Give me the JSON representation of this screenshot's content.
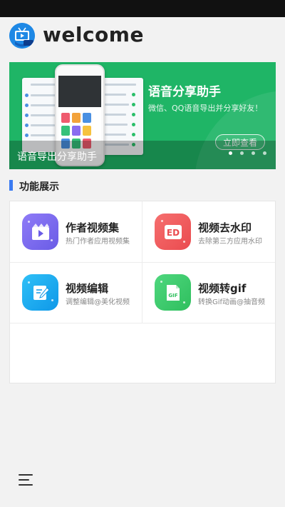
{
  "header": {
    "title": "welcome",
    "logo_icon": "tv-icon"
  },
  "banner": {
    "heading": "语音分享助手",
    "subtext": "微信、QQ语音导出并分享好友！",
    "cta_label": "立即查看",
    "caption": "语音导出分享助手",
    "background_color": "#1fb566",
    "slide_count": 4,
    "active_slide": 1
  },
  "section": {
    "title": "功能展示",
    "accent_color": "#3a7bf2"
  },
  "features": [
    {
      "title": "作者视频集",
      "desc": "热门作者应用视频集",
      "icon": "film-icon",
      "color": "#7b6cf2"
    },
    {
      "title": "视频去水印",
      "desc": "去除第三方应用水印",
      "icon": "ed-badge-icon",
      "color": "#f0575a"
    },
    {
      "title": "视频编辑",
      "desc": "调整编辑@美化视频",
      "icon": "edit-icon",
      "color": "#1aaef0"
    },
    {
      "title": "视频转gif",
      "desc": "转换Gif动画@抽音频",
      "icon": "gif-icon",
      "color": "#3fcf6e"
    }
  ],
  "bottom": {
    "menu_icon": "menu-icon"
  }
}
